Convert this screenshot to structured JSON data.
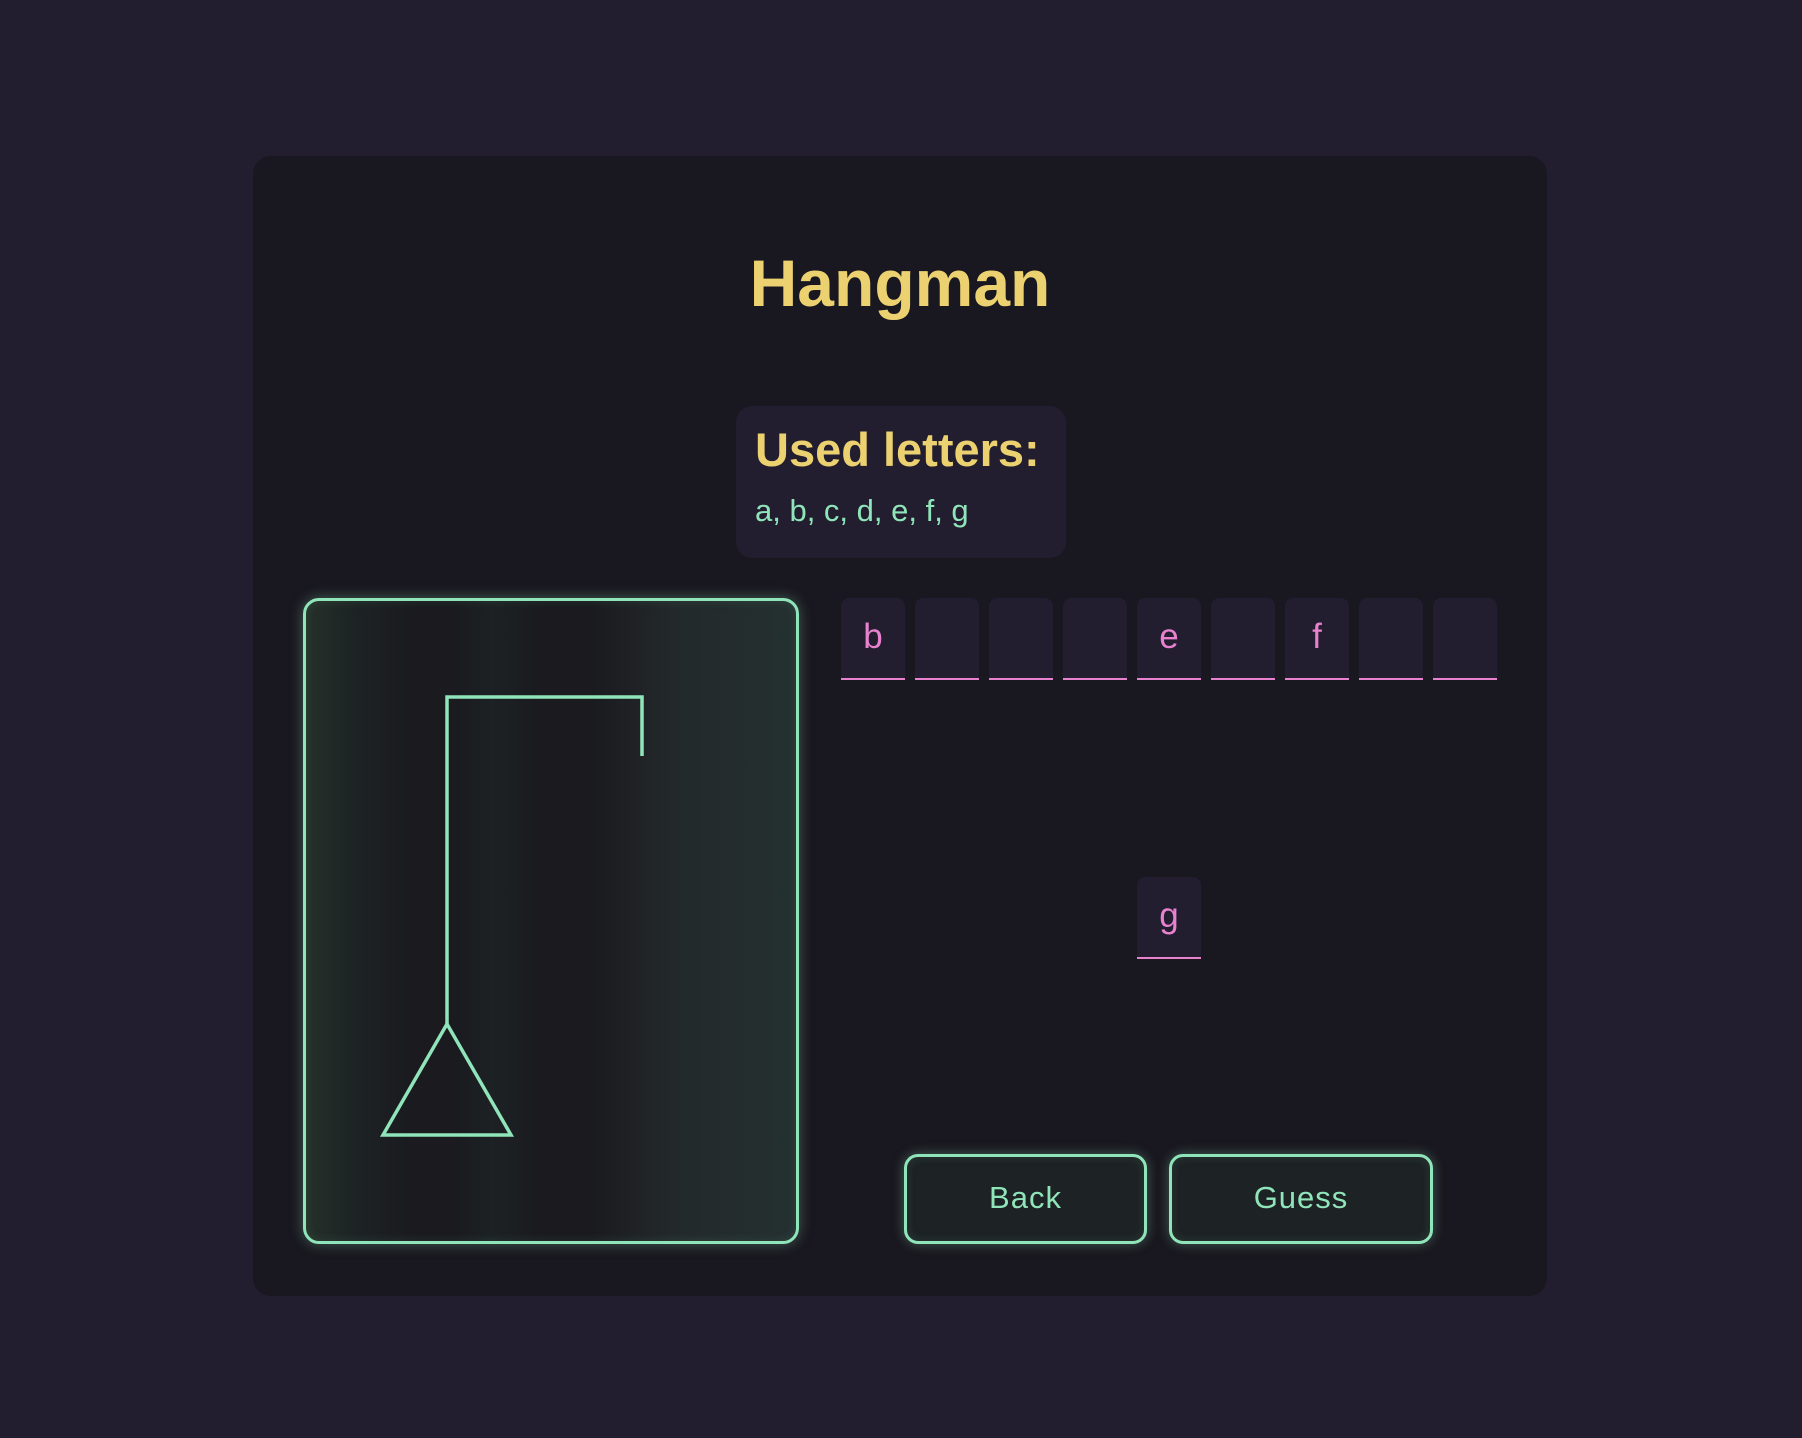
{
  "game": {
    "title": "Hangman",
    "used_letters_title": "Used letters:",
    "used_letters": "a, b, c, d, e, f, g",
    "word_slots": [
      "b",
      "",
      "",
      "",
      "e",
      "",
      "f",
      "",
      ""
    ],
    "wrong_guesses": [
      "g"
    ],
    "hangman_stage": "gallows-only"
  },
  "buttons": {
    "back_label": "Back",
    "guess_label": "Guess"
  },
  "colors": {
    "background": "#221d2f",
    "card": "#19171f",
    "title_yellow": "#ecd170",
    "accent_green": "#8fe5b9",
    "letter_pink": "#e882cf"
  }
}
